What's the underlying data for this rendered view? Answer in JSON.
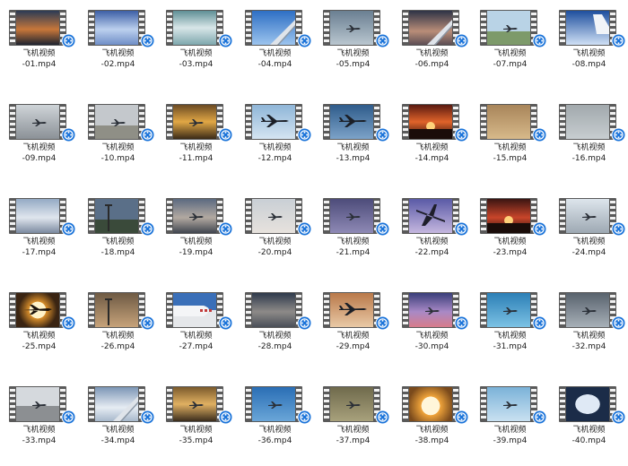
{
  "colors": {
    "background": "#ffffff",
    "badge": "#1a73d9"
  },
  "badge_icon": "video-player-icon",
  "files": [
    {
      "name": "飞机视频",
      "ext": "-01.mp4",
      "scene": "sunset"
    },
    {
      "name": "飞机视频",
      "ext": "-02.mp4",
      "scene": "clouds-blue"
    },
    {
      "name": "飞机视频",
      "ext": "-03.mp4",
      "scene": "clouds-teal"
    },
    {
      "name": "飞机视频",
      "ext": "-04.mp4",
      "scene": "sky-wing"
    },
    {
      "name": "飞机视频",
      "ext": "-05.mp4",
      "scene": "haze-plane"
    },
    {
      "name": "飞机视频",
      "ext": "-06.mp4",
      "scene": "dusk-wing"
    },
    {
      "name": "飞机视频",
      "ext": "-07.mp4",
      "scene": "runway"
    },
    {
      "name": "飞机视频",
      "ext": "-08.mp4",
      "scene": "blue-tail"
    },
    {
      "name": "飞机视频",
      "ext": "-09.mp4",
      "scene": "hangar"
    },
    {
      "name": "飞机视频",
      "ext": "-10.mp4",
      "scene": "grey-runway"
    },
    {
      "name": "飞机视频",
      "ext": "-11.mp4",
      "scene": "golden"
    },
    {
      "name": "飞机视频",
      "ext": "-12.mp4",
      "scene": "sky-plane"
    },
    {
      "name": "飞机视频",
      "ext": "-13.mp4",
      "scene": "blue-plane"
    },
    {
      "name": "飞机视频",
      "ext": "-14.mp4",
      "scene": "red-sunset"
    },
    {
      "name": "飞机视频",
      "ext": "-15.mp4",
      "scene": "sand"
    },
    {
      "name": "飞机视频",
      "ext": "-16.mp4",
      "scene": "grey-sky"
    },
    {
      "name": "飞机视频",
      "ext": "-17.mp4",
      "scene": "mountains"
    },
    {
      "name": "飞机视频",
      "ext": "-18.mp4",
      "scene": "dusk-field"
    },
    {
      "name": "飞机视频",
      "ext": "-19.mp4",
      "scene": "airport-dusk"
    },
    {
      "name": "飞机视频",
      "ext": "-20.mp4",
      "scene": "pale-plane"
    },
    {
      "name": "飞机视频",
      "ext": "-21.mp4",
      "scene": "purple-plane"
    },
    {
      "name": "飞机视频",
      "ext": "-22.mp4",
      "scene": "purple-silhouette"
    },
    {
      "name": "飞机视频",
      "ext": "-23.mp4",
      "scene": "red-sun"
    },
    {
      "name": "飞机视频",
      "ext": "-24.mp4",
      "scene": "terminal"
    },
    {
      "name": "飞机视频",
      "ext": "-25.mp4",
      "scene": "sun-plane"
    },
    {
      "name": "飞机视频",
      "ext": "-26.mp4",
      "scene": "crane"
    },
    {
      "name": "飞机视频",
      "ext": "-27.mp4",
      "scene": "jet-nose"
    },
    {
      "name": "飞机视频",
      "ext": "-28.mp4",
      "scene": "storm"
    },
    {
      "name": "飞机视频",
      "ext": "-29.mp4",
      "scene": "orange-plane"
    },
    {
      "name": "飞机视频",
      "ext": "-30.mp4",
      "scene": "purple-clouds"
    },
    {
      "name": "飞机视频",
      "ext": "-31.mp4",
      "scene": "cyan-sky"
    },
    {
      "name": "飞机视频",
      "ext": "-32.mp4",
      "scene": "grey-plane"
    },
    {
      "name": "飞机视频",
      "ext": "-33.mp4",
      "scene": "apron"
    },
    {
      "name": "飞机视频",
      "ext": "-34.mp4",
      "scene": "cloud-wing"
    },
    {
      "name": "飞机视频",
      "ext": "-35.mp4",
      "scene": "gold-runway"
    },
    {
      "name": "飞机视频",
      "ext": "-36.mp4",
      "scene": "blue-dot"
    },
    {
      "name": "飞机视频",
      "ext": "-37.mp4",
      "scene": "olive"
    },
    {
      "name": "飞机视频",
      "ext": "-38.mp4",
      "scene": "big-sun"
    },
    {
      "name": "飞机视频",
      "ext": "-39.mp4",
      "scene": "light-blue-plane"
    },
    {
      "name": "飞机视频",
      "ext": "-40.mp4",
      "scene": "window"
    }
  ]
}
